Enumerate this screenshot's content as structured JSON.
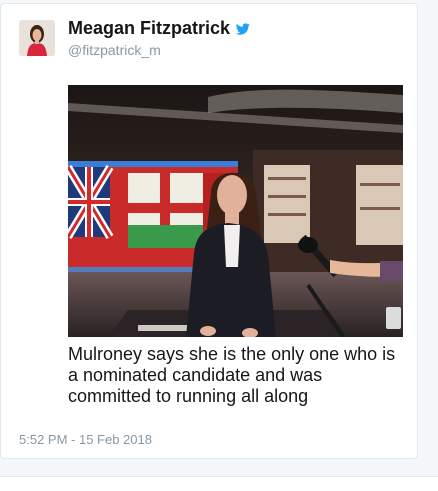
{
  "tweet": {
    "display_name": "Meagan Fitzpatrick",
    "handle": "@fitzpatrick_m",
    "text": "Mulroney says she is the only one who is a nominated candidate and was committed to running all along",
    "timestamp": "5:52 PM - 15 Feb 2018",
    "media_description_icon": "tv-studio-photo"
  },
  "colors": {
    "verified_blue": "#1da1f2",
    "text": "#14171a",
    "muted": "#8899a6",
    "border": "#e1e8ed"
  }
}
